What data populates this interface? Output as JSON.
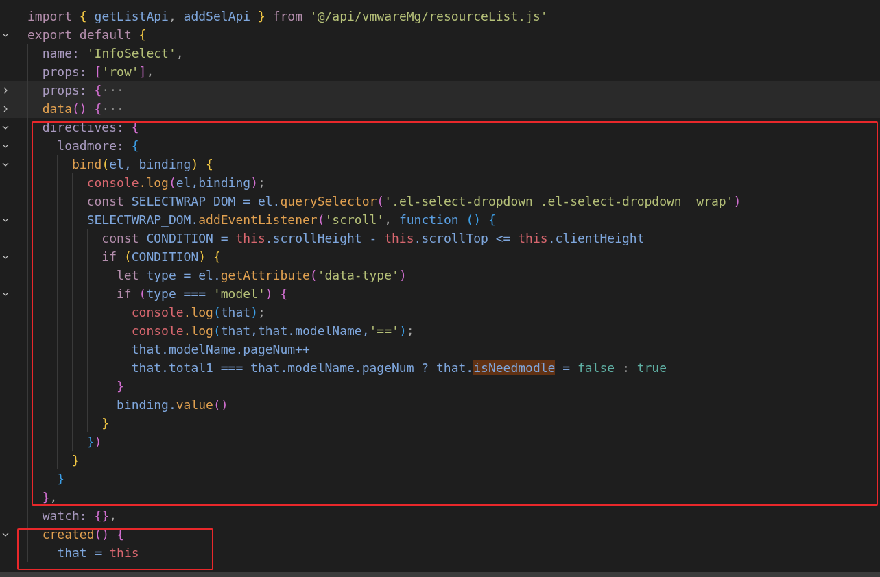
{
  "editor": {
    "blocks": [
      {
        "kind": "plain",
        "lines": [
          {
            "highlighted": false,
            "foldable": false,
            "segments": [
              {
                "kind": "kw",
                "text": "import "
              },
              {
                "kind": "b1",
                "text": "{ "
              },
              {
                "kind": "var",
                "text": "getListApi"
              },
              {
                "kind": "p",
                "text": ", "
              },
              {
                "kind": "var",
                "text": "addSelApi "
              },
              {
                "kind": "b1",
                "text": "} "
              },
              {
                "kind": "kw",
                "text": "from "
              },
              {
                "kind": "str",
                "text": "'@/api/vmwareMg/resourceList.js'"
              }
            ]
          },
          {
            "highlighted": false,
            "foldable": true,
            "expanded": true,
            "segments": [
              {
                "kind": "kw",
                "text": "export default "
              },
              {
                "kind": "b1",
                "text": "{"
              }
            ]
          },
          {
            "highlighted": false,
            "foldable": false,
            "segments": [
              {
                "kind": "prop",
                "text": "  name: "
              },
              {
                "kind": "str",
                "text": "'InfoSelect'"
              },
              {
                "kind": "p",
                "text": ","
              }
            ]
          },
          {
            "highlighted": false,
            "foldable": false,
            "segments": [
              {
                "kind": "prop",
                "text": "  props: "
              },
              {
                "kind": "b2",
                "text": "["
              },
              {
                "kind": "str",
                "text": "'row'"
              },
              {
                "kind": "b2",
                "text": "]"
              },
              {
                "kind": "p",
                "text": ","
              }
            ]
          },
          {
            "highlighted": true,
            "foldable": true,
            "expanded": false,
            "segments": [
              {
                "kind": "prop",
                "text": "  props: "
              },
              {
                "kind": "b2",
                "text": "{"
              },
              {
                "kind": "dots",
                "text": "···"
              }
            ]
          },
          {
            "highlighted": true,
            "foldable": true,
            "expanded": false,
            "segments": [
              {
                "kind": "fn",
                "text": "  data"
              },
              {
                "kind": "b2",
                "text": "() {"
              },
              {
                "kind": "dots",
                "text": "···"
              }
            ]
          }
        ]
      },
      {
        "kind": "wide-box",
        "lines": [
          {
            "highlighted": false,
            "foldable": true,
            "expanded": true,
            "segments": [
              {
                "kind": "prop",
                "text": "  directives: "
              },
              {
                "kind": "b2",
                "text": "{"
              }
            ]
          },
          {
            "highlighted": false,
            "foldable": true,
            "expanded": true,
            "segments": [
              {
                "kind": "prop",
                "text": "    loadmore: "
              },
              {
                "kind": "b3",
                "text": "{"
              }
            ]
          },
          {
            "highlighted": false,
            "foldable": true,
            "expanded": true,
            "segments": [
              {
                "kind": "fn",
                "text": "      bind"
              },
              {
                "kind": "b1",
                "text": "("
              },
              {
                "kind": "var",
                "text": "el, binding"
              },
              {
                "kind": "b1",
                "text": ") {"
              }
            ]
          },
          {
            "highlighted": false,
            "foldable": false,
            "segments": [
              {
                "kind": "this",
                "text": "        console"
              },
              {
                "kind": "fn",
                "text": ".log"
              },
              {
                "kind": "b2",
                "text": "("
              },
              {
                "kind": "var",
                "text": "el,binding"
              },
              {
                "kind": "b2",
                "text": ")"
              },
              {
                "kind": "p",
                "text": ";"
              }
            ]
          },
          {
            "highlighted": false,
            "foldable": false,
            "segments": [
              {
                "kind": "kw",
                "text": "        const "
              },
              {
                "kind": "var",
                "text": "SELECTWRAP_DOM = el."
              },
              {
                "kind": "fn",
                "text": "querySelector"
              },
              {
                "kind": "b2",
                "text": "("
              },
              {
                "kind": "str",
                "text": "'.el-select-dropdown .el-select-dropdown__wrap'"
              },
              {
                "kind": "b2",
                "text": ")"
              }
            ]
          },
          {
            "highlighted": false,
            "foldable": true,
            "expanded": true,
            "segments": [
              {
                "kind": "var",
                "text": "        SELECTWRAP_DOM."
              },
              {
                "kind": "fn",
                "text": "addEventListener"
              },
              {
                "kind": "b2",
                "text": "("
              },
              {
                "kind": "str",
                "text": "'scroll'"
              },
              {
                "kind": "p",
                "text": ", "
              },
              {
                "kind": "kwb",
                "text": "function "
              },
              {
                "kind": "b3",
                "text": "() {"
              }
            ]
          },
          {
            "highlighted": false,
            "foldable": false,
            "segments": [
              {
                "kind": "kw",
                "text": "          const "
              },
              {
                "kind": "var",
                "text": "CONDITION = "
              },
              {
                "kind": "this",
                "text": "this"
              },
              {
                "kind": "var",
                "text": ".scrollHeight - "
              },
              {
                "kind": "this",
                "text": "this"
              },
              {
                "kind": "var",
                "text": ".scrollTop <= "
              },
              {
                "kind": "this",
                "text": "this"
              },
              {
                "kind": "var",
                "text": ".clientHeight"
              }
            ]
          },
          {
            "highlighted": false,
            "foldable": true,
            "expanded": true,
            "segments": [
              {
                "kind": "kw",
                "text": "          if "
              },
              {
                "kind": "b1",
                "text": "("
              },
              {
                "kind": "var",
                "text": "CONDITION"
              },
              {
                "kind": "b1",
                "text": ") {"
              }
            ]
          },
          {
            "highlighted": false,
            "foldable": false,
            "segments": [
              {
                "kind": "kw",
                "text": "            let "
              },
              {
                "kind": "var",
                "text": "type = el."
              },
              {
                "kind": "fn",
                "text": "getAttribute"
              },
              {
                "kind": "b2",
                "text": "("
              },
              {
                "kind": "str",
                "text": "'data-type'"
              },
              {
                "kind": "b2",
                "text": ")"
              }
            ]
          },
          {
            "highlighted": false,
            "foldable": true,
            "expanded": true,
            "segments": [
              {
                "kind": "kw",
                "text": "            if "
              },
              {
                "kind": "b2",
                "text": "("
              },
              {
                "kind": "var",
                "text": "type === "
              },
              {
                "kind": "str",
                "text": "'model'"
              },
              {
                "kind": "b2",
                "text": ") {"
              }
            ]
          },
          {
            "highlighted": false,
            "foldable": false,
            "segments": [
              {
                "kind": "this",
                "text": "              console"
              },
              {
                "kind": "fn",
                "text": ".log"
              },
              {
                "kind": "b3",
                "text": "("
              },
              {
                "kind": "var",
                "text": "that"
              },
              {
                "kind": "b3",
                "text": ")"
              },
              {
                "kind": "p",
                "text": ";"
              }
            ]
          },
          {
            "highlighted": false,
            "foldable": false,
            "segments": [
              {
                "kind": "this",
                "text": "              console"
              },
              {
                "kind": "fn",
                "text": ".log"
              },
              {
                "kind": "b3",
                "text": "("
              },
              {
                "kind": "var",
                "text": "that,that.modelName,"
              },
              {
                "kind": "str",
                "text": "'=='"
              },
              {
                "kind": "b3",
                "text": ")"
              },
              {
                "kind": "p",
                "text": ";"
              }
            ]
          },
          {
            "highlighted": false,
            "foldable": false,
            "segments": [
              {
                "kind": "var",
                "text": "              that.modelName.pageNum++"
              }
            ]
          },
          {
            "highlighted": false,
            "foldable": false,
            "segments": [
              {
                "kind": "var",
                "text": "              that.total1 === that.modelName.pageNum ? that."
              },
              {
                "kind": "mark",
                "text": "isNeedmodle"
              },
              {
                "kind": "var",
                "text": " = "
              },
              {
                "kind": "bool",
                "text": "false "
              },
              {
                "kind": "p",
                "text": ": "
              },
              {
                "kind": "bool",
                "text": "true"
              }
            ]
          },
          {
            "highlighted": false,
            "foldable": false,
            "segments": [
              {
                "kind": "b2",
                "text": "            }"
              }
            ]
          },
          {
            "highlighted": false,
            "foldable": false,
            "segments": [
              {
                "kind": "var",
                "text": "            binding."
              },
              {
                "kind": "fn",
                "text": "value"
              },
              {
                "kind": "b2",
                "text": "()"
              }
            ]
          },
          {
            "highlighted": false,
            "foldable": false,
            "segments": [
              {
                "kind": "b1",
                "text": "          }"
              }
            ]
          },
          {
            "highlighted": false,
            "foldable": false,
            "segments": [
              {
                "kind": "b3",
                "text": "        }"
              },
              {
                "kind": "b2",
                "text": ")"
              }
            ]
          },
          {
            "highlighted": false,
            "foldable": false,
            "segments": [
              {
                "kind": "b1",
                "text": "      }"
              }
            ]
          },
          {
            "highlighted": false,
            "foldable": false,
            "segments": [
              {
                "kind": "b3",
                "text": "    }"
              }
            ]
          },
          {
            "highlighted": false,
            "foldable": false,
            "segments": [
              {
                "kind": "b2",
                "text": "  }"
              },
              {
                "kind": "p",
                "text": ","
              }
            ]
          }
        ]
      },
      {
        "kind": "plain",
        "lines": [
          {
            "highlighted": false,
            "foldable": false,
            "segments": [
              {
                "kind": "prop",
                "text": "  watch: "
              },
              {
                "kind": "b2",
                "text": "{}"
              },
              {
                "kind": "p",
                "text": ","
              }
            ]
          }
        ]
      },
      {
        "kind": "fit-box",
        "lines": [
          {
            "highlighted": false,
            "foldable": true,
            "expanded": true,
            "segments": [
              {
                "kind": "fn",
                "text": "  created"
              },
              {
                "kind": "b2",
                "text": "() {"
              }
            ]
          },
          {
            "highlighted": false,
            "foldable": false,
            "segments": [
              {
                "kind": "var",
                "text": "    that = "
              },
              {
                "kind": "this",
                "text": "this"
              }
            ]
          }
        ]
      }
    ]
  }
}
